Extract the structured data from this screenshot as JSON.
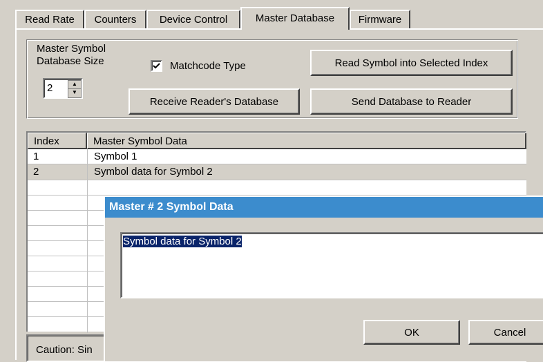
{
  "tabs": [
    "Read Rate",
    "Counters",
    "Device Control",
    "Master Database",
    "Firmware"
  ],
  "group": {
    "size_label_line1": "Master Symbol",
    "size_label_line2": "Database Size",
    "size_value": "2",
    "matchcode_label": "Matchcode Type",
    "matchcode_checked": true,
    "read_symbol_button": "Read Symbol into Selected Index",
    "receive_button": "Receive Reader's Database",
    "send_button": "Send Database to Reader"
  },
  "table": {
    "columns": [
      "Index",
      "Master Symbol Data"
    ],
    "rows": [
      {
        "index": "1",
        "data": "Symbol 1"
      },
      {
        "index": "2",
        "data": "Symbol data for Symbol 2"
      }
    ]
  },
  "caution_text": "Caution: Sin",
  "dialog": {
    "title": "Master # 2 Symbol Data",
    "text": "Symbol data for Symbol 2",
    "ok_label": "OK",
    "cancel_label": "Cancel"
  }
}
